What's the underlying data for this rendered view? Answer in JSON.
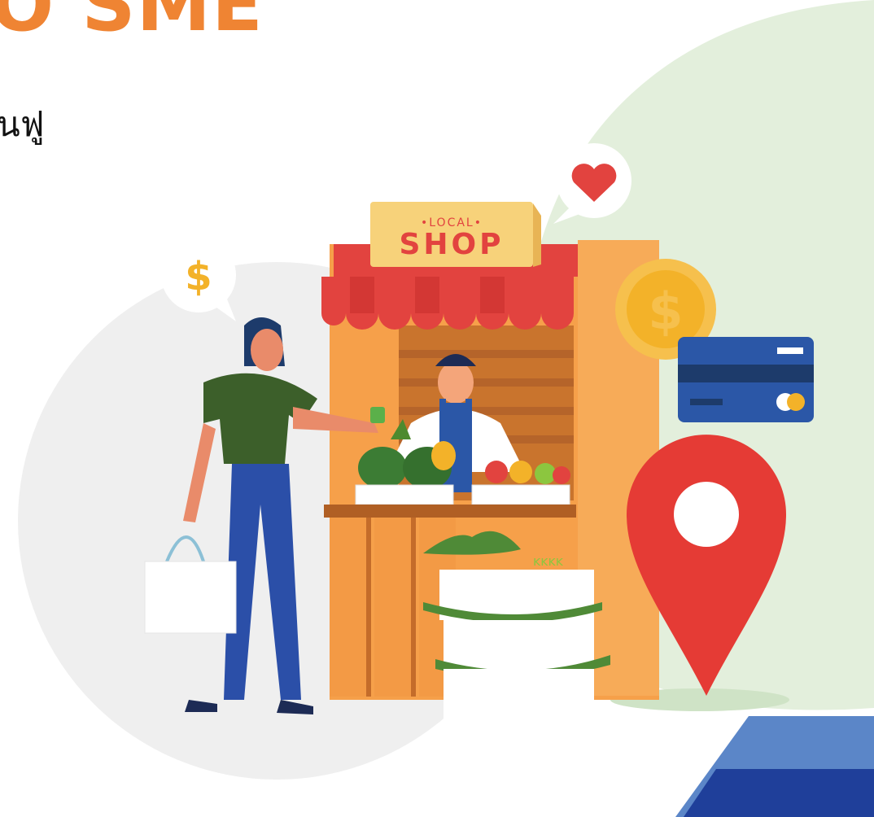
{
  "header": {
    "headline": "O SME",
    "subline": "นฟู"
  },
  "illustration": {
    "sign_top": "•LOCAL•",
    "sign_main": "SHOP",
    "coin_symbol": "$",
    "bubble_symbol": "$"
  },
  "colors": {
    "headline": "#ef8433",
    "green_blob": "#e3efdc",
    "grey_blob": "#efefef",
    "awning_red": "#e2433f",
    "stall_orange": "#f6a04a",
    "pin_red": "#e53b35",
    "card_blue": "#2b57a7",
    "accent_blue": "#1f3f9a"
  }
}
